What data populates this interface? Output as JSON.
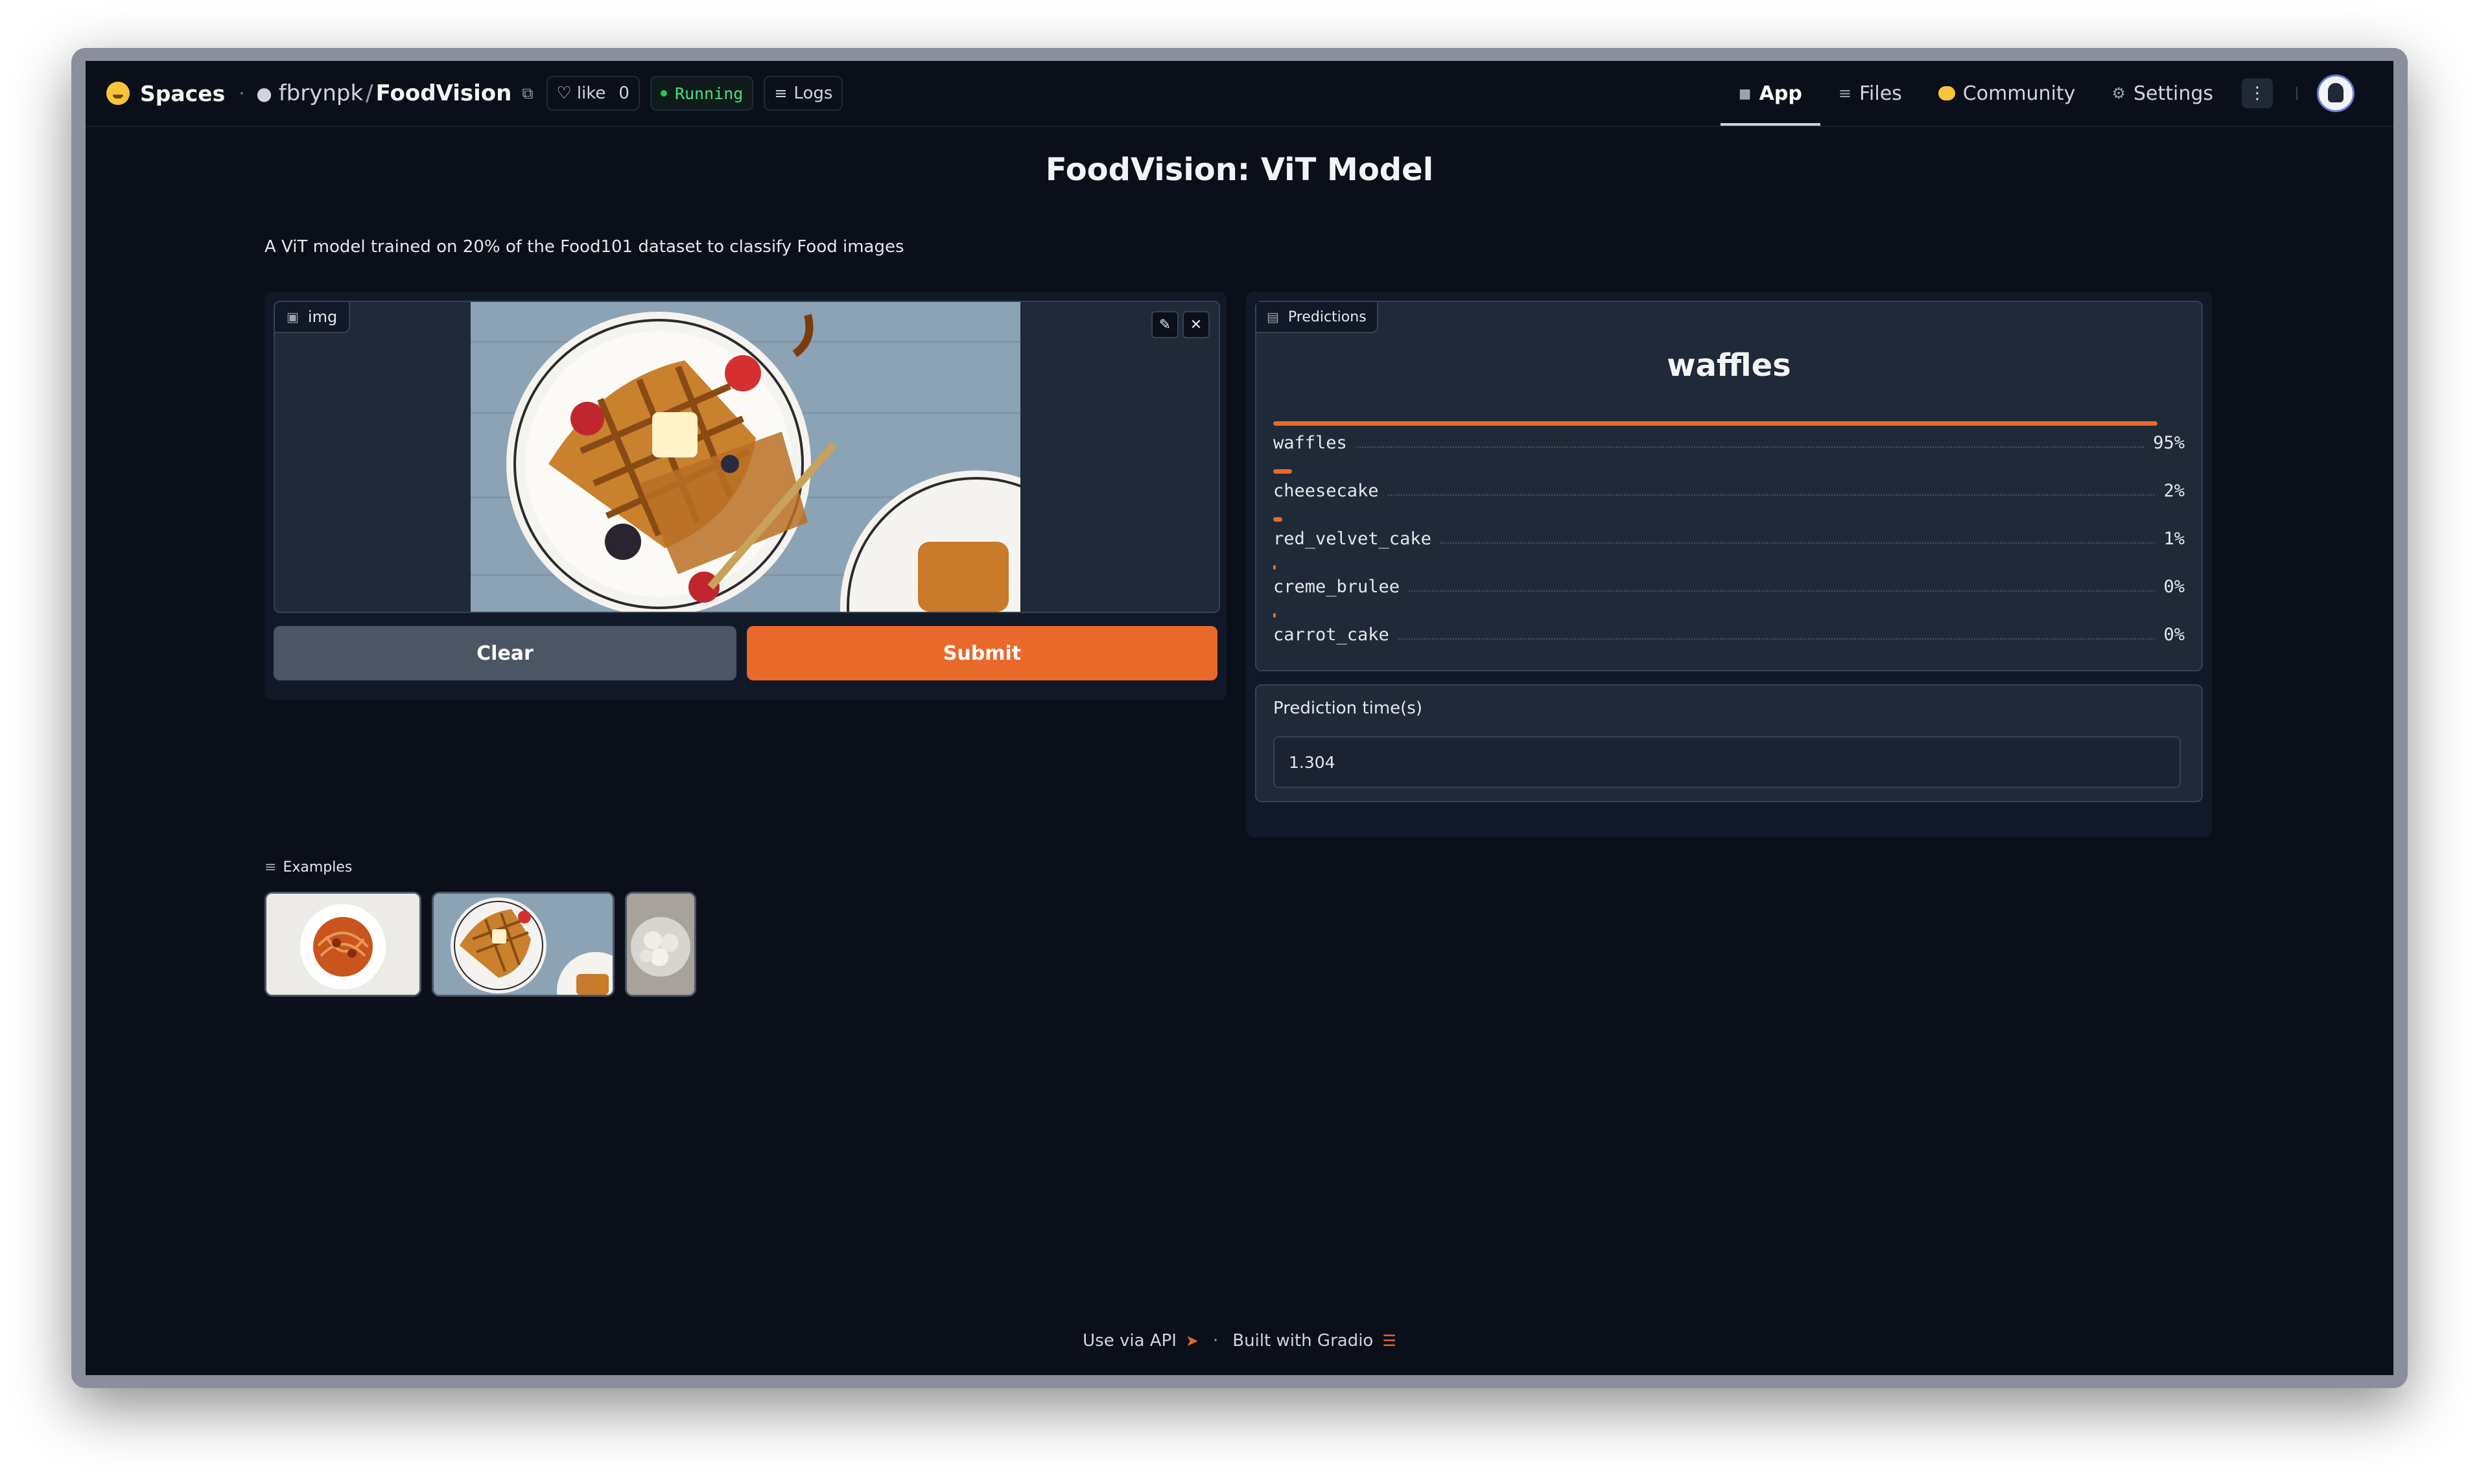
{
  "header": {
    "brand": "Spaces",
    "owner": "fbrynpk",
    "separator": "/",
    "repo": "FoodVision",
    "like_label": "like",
    "like_count": "0",
    "status": "Running",
    "logs_label": "Logs",
    "nav": [
      {
        "label": "App",
        "active": true
      },
      {
        "label": "Files",
        "active": false
      },
      {
        "label": "Community",
        "active": false
      },
      {
        "label": "Settings",
        "active": false
      }
    ]
  },
  "main": {
    "title": "FoodVision: ViT Model",
    "description": "A ViT model trained on 20% of the Food101 dataset to classify Food images"
  },
  "input": {
    "label": "img",
    "clear_label": "Clear",
    "submit_label": "Submit"
  },
  "predictions": {
    "label": "Predictions",
    "top_label": "waffles",
    "items": [
      {
        "label": "waffles",
        "percent": "95%",
        "value": 0.95
      },
      {
        "label": "cheesecake",
        "percent": "2%",
        "value": 0.02
      },
      {
        "label": "red_velvet_cake",
        "percent": "1%",
        "value": 0.01
      },
      {
        "label": "creme_brulee",
        "percent": "0%",
        "value": 0.003
      },
      {
        "label": "carrot_cake",
        "percent": "0%",
        "value": 0.002
      }
    ],
    "accent": "#e8692a"
  },
  "prediction_time": {
    "label": "Prediction time(s)",
    "value": "1.304"
  },
  "examples": {
    "label": "Examples"
  },
  "footer": {
    "api_label": "Use via API",
    "separator": "·",
    "built_label": "Built with Gradio"
  }
}
